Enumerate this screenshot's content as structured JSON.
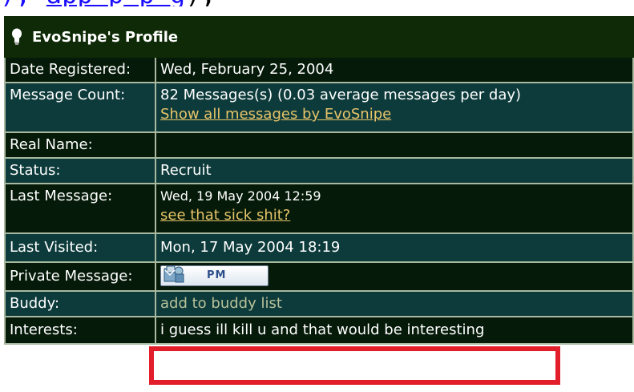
{
  "url_fragment": {
    "left": "), ",
    "link": "app    ",
    "mid": "    p",
    "link2": "   p g",
    "tail": "),"
  },
  "profile": {
    "title": "EvoSnipe's Profile",
    "rows": {
      "date_registered": {
        "label": "Date Registered:",
        "value": "Wed, February 25, 2004"
      },
      "message_count": {
        "label": "Message Count:",
        "value": "82 Messages(s) (0.03 average messages per day)",
        "link": "Show all messages by EvoSnipe"
      },
      "real_name": {
        "label": "Real Name:",
        "value": ""
      },
      "status": {
        "label": "Status:",
        "value": "Recruit"
      },
      "last_message": {
        "label": "Last Message:",
        "value": "Wed, 19 May 2004 12:59",
        "link": "see that sick shit?"
      },
      "last_visited": {
        "label": "Last Visited:",
        "value": "Mon, 17 May 2004 18:19"
      },
      "private_message": {
        "label": "Private Message:",
        "button": "PM"
      },
      "buddy": {
        "label": "Buddy:",
        "link": "add to buddy list"
      },
      "interests": {
        "label": "Interests:",
        "value": "i guess ill kill u and that would be interesting"
      }
    }
  },
  "colors": {
    "header_bg": "#0e2a06",
    "row_dark": "#051a09",
    "row_teal": "#0d3a3a",
    "link": "#e7c46a",
    "highlight": "#e11e2a"
  },
  "icons": {
    "header": "lightbulb-icon",
    "pm": "pm-envelope-icon"
  }
}
